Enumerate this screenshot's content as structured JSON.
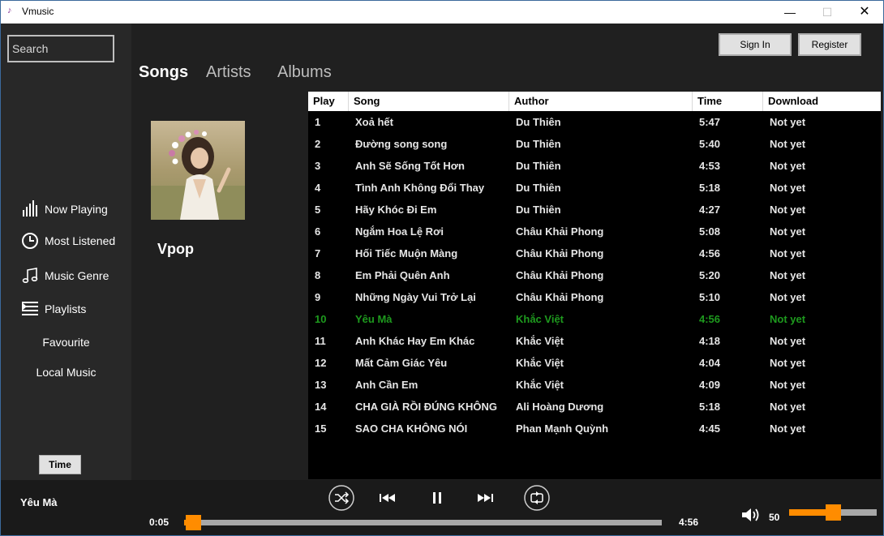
{
  "app": {
    "title": "Vmusic"
  },
  "window_controls": {
    "minimize": "—",
    "maximize": "☐",
    "close": "✕"
  },
  "sidebar": {
    "search_placeholder": "Search",
    "items": [
      {
        "label": "Now Playing",
        "icon": "bars-icon"
      },
      {
        "label": "Most Listened",
        "icon": "clock-icon"
      },
      {
        "label": "Music Genre",
        "icon": "music-note-icon"
      },
      {
        "label": "Playlists",
        "icon": "playlist-icon"
      },
      {
        "label": "Favourite"
      },
      {
        "label": "Local Music"
      }
    ],
    "time_button": "Time"
  },
  "header": {
    "sign_in": "Sign In",
    "register": "Register"
  },
  "tabs": [
    {
      "label": "Songs",
      "active": true
    },
    {
      "label": "Artists",
      "active": false
    },
    {
      "label": "Albums",
      "active": false
    }
  ],
  "album": {
    "genre": "Vpop"
  },
  "table": {
    "columns": [
      "Play",
      "Song",
      "Author",
      "Time",
      "Download"
    ],
    "rows": [
      [
        "1",
        "Xoả hết",
        "Du Thiên",
        "5:47",
        "Not yet"
      ],
      [
        "2",
        "Đường song song",
        "Du Thiên",
        "5:40",
        "Not yet"
      ],
      [
        "3",
        "Anh Sẽ Sống Tốt Hơn",
        "Du Thiên",
        "4:53",
        "Not yet"
      ],
      [
        "4",
        "Tình Anh Không Đổi Thay",
        "Du Thiên",
        "5:18",
        "Not yet"
      ],
      [
        "5",
        "Hãy Khóc Đi Em",
        "Du Thiên",
        "4:27",
        "Not yet"
      ],
      [
        "6",
        "Ngắm Hoa Lệ Rơi",
        "Châu Khải Phong",
        "5:08",
        "Not yet"
      ],
      [
        "7",
        "Hối Tiếc Muộn Màng",
        "Châu Khải Phong",
        "4:56",
        "Not yet"
      ],
      [
        "8",
        "Em Phải Quên Anh",
        "Châu Khải Phong",
        "5:20",
        "Not yet"
      ],
      [
        "9",
        "Những Ngày Vui Trở Lại",
        "Châu Khải Phong",
        "5:10",
        "Not yet"
      ],
      [
        "10",
        "Yêu Mà",
        "Khắc Việt",
        "4:56",
        "Not yet"
      ],
      [
        "11",
        "Anh Khác Hay Em Khác",
        "Khắc Việt",
        "4:18",
        "Not yet"
      ],
      [
        "12",
        "Mất Cảm Giác Yêu",
        "Khắc Việt",
        "4:04",
        "Not yet"
      ],
      [
        "13",
        "Anh Cần Em",
        "Khắc Việt",
        "4:09",
        "Not yet"
      ],
      [
        "14",
        "CHA GIÀ RỒI ĐÚNG KHÔNG",
        "Ali Hoàng Dương",
        "5:18",
        "Not yet"
      ],
      [
        "15",
        "SAO CHA KHÔNG NÓI",
        "Phan Mạnh Quỳnh",
        "4:45",
        "Not yet"
      ]
    ],
    "playing_index": 9
  },
  "player": {
    "now_playing": "Yêu Mà",
    "current_time": "0:05",
    "total_time": "4:56",
    "progress_fraction": 0.017,
    "volume": "50",
    "volume_fraction": 0.5
  },
  "colors": {
    "accent": "#ff8c00",
    "playing": "#1e9a1e",
    "background": "#282828",
    "table_bg": "#000000"
  }
}
